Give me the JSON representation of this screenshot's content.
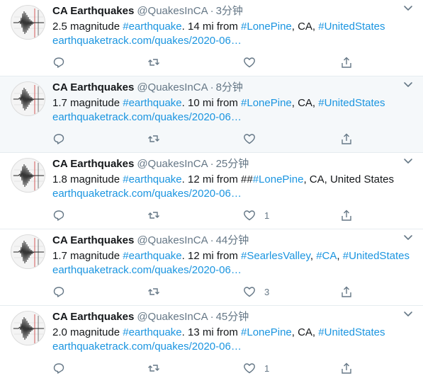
{
  "tweets": [
    {
      "name": "CA Earthquakes",
      "handle": "@QuakesInCA",
      "sep": "·",
      "time": "3分钟",
      "parts": [
        {
          "text": "2.5 magnitude ",
          "link": false
        },
        {
          "text": "#earthquake",
          "link": true
        },
        {
          "text": ". 14 mi from ",
          "link": false
        },
        {
          "text": "#LonePine",
          "link": true
        },
        {
          "text": ", CA, ",
          "link": false
        },
        {
          "text": "#UnitedStates",
          "link": true
        }
      ],
      "url": "earthquaketrack.com/quakes/2020-06…",
      "likes": ""
    },
    {
      "name": "CA Earthquakes",
      "handle": "@QuakesInCA",
      "sep": "·",
      "time": "8分钟",
      "parts": [
        {
          "text": "1.7 magnitude ",
          "link": false
        },
        {
          "text": "#earthquake",
          "link": true
        },
        {
          "text": ". 10 mi from ",
          "link": false
        },
        {
          "text": "#LonePine",
          "link": true
        },
        {
          "text": ", CA, ",
          "link": false
        },
        {
          "text": "#UnitedStates",
          "link": true
        }
      ],
      "url": "earthquaketrack.com/quakes/2020-06…",
      "likes": ""
    },
    {
      "name": "CA Earthquakes",
      "handle": "@QuakesInCA",
      "sep": "·",
      "time": "25分钟",
      "parts": [
        {
          "text": "1.8 magnitude ",
          "link": false
        },
        {
          "text": "#earthquake",
          "link": true
        },
        {
          "text": ". 12 mi from ##",
          "link": false
        },
        {
          "text": "#LonePine",
          "link": true
        },
        {
          "text": ", CA, United States",
          "link": false
        }
      ],
      "url": "earthquaketrack.com/quakes/2020-06…",
      "likes": "1"
    },
    {
      "name": "CA Earthquakes",
      "handle": "@QuakesInCA",
      "sep": "·",
      "time": "44分钟",
      "parts": [
        {
          "text": "1.7 magnitude ",
          "link": false
        },
        {
          "text": "#earthquake",
          "link": true
        },
        {
          "text": ". 12 mi from ",
          "link": false
        },
        {
          "text": "#SearlesValley",
          "link": true
        },
        {
          "text": ", ",
          "link": false
        },
        {
          "text": "#CA",
          "link": true
        },
        {
          "text": ", ",
          "link": false
        },
        {
          "text": "#UnitedStates",
          "link": true
        }
      ],
      "url": "earthquaketrack.com/quakes/2020-06…",
      "likes": "3"
    },
    {
      "name": "CA Earthquakes",
      "handle": "@QuakesInCA",
      "sep": "·",
      "time": "45分钟",
      "parts": [
        {
          "text": "2.0 magnitude ",
          "link": false
        },
        {
          "text": "#earthquake",
          "link": true
        },
        {
          "text": ". 13 mi from ",
          "link": false
        },
        {
          "text": "#LonePine",
          "link": true
        },
        {
          "text": ", CA, ",
          "link": false
        },
        {
          "text": "#UnitedStates",
          "link": true
        }
      ],
      "url": "earthquaketrack.com/quakes/2020-06…",
      "likes": "1"
    }
  ],
  "hover_index": 1,
  "icons": {
    "avatar": "seismograph-icon",
    "menu": "chevron-down-icon",
    "reply": "reply-icon",
    "retweet": "retweet-icon",
    "like": "heart-icon",
    "share": "share-icon"
  },
  "colors": {
    "link": "#1b95e0",
    "muted": "#657786",
    "hover_bg": "#f5f8fa",
    "divider": "#e6ecf0"
  }
}
